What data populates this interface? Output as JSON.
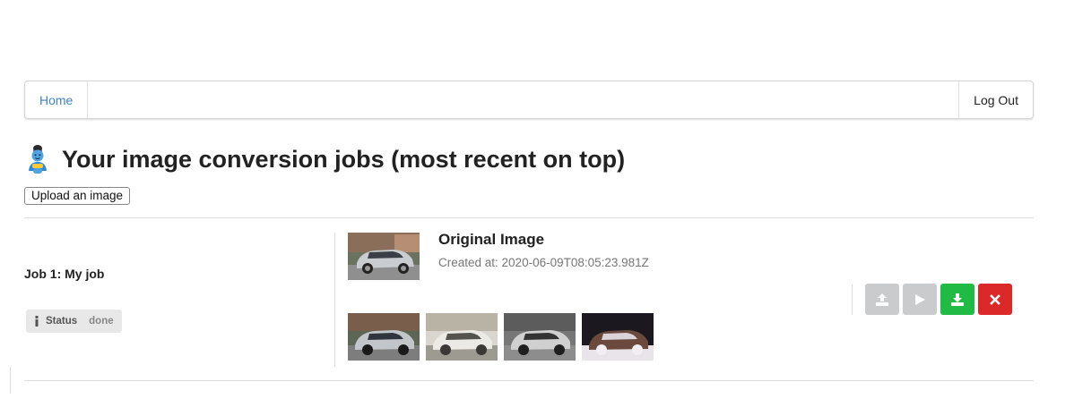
{
  "nav": {
    "home_label": "Home",
    "logout_label": "Log Out"
  },
  "page": {
    "title": "Your image conversion jobs (most recent on top)",
    "upload_button_label": "Upload an image"
  },
  "jobs": [
    {
      "name": "Job 1: My job",
      "status_label": "Status",
      "status_value": "done",
      "original_title": "Original Image",
      "created_at": "Created at: 2020-06-09T08:05:23.981Z",
      "actions": [
        "upload-icon",
        "play-icon",
        "download-icon",
        "close-icon"
      ]
    }
  ],
  "colors": {
    "link": "#4183c4",
    "button_disabled": "#cacbcd",
    "button_download": "#21ba45",
    "button_delete": "#db2828"
  }
}
